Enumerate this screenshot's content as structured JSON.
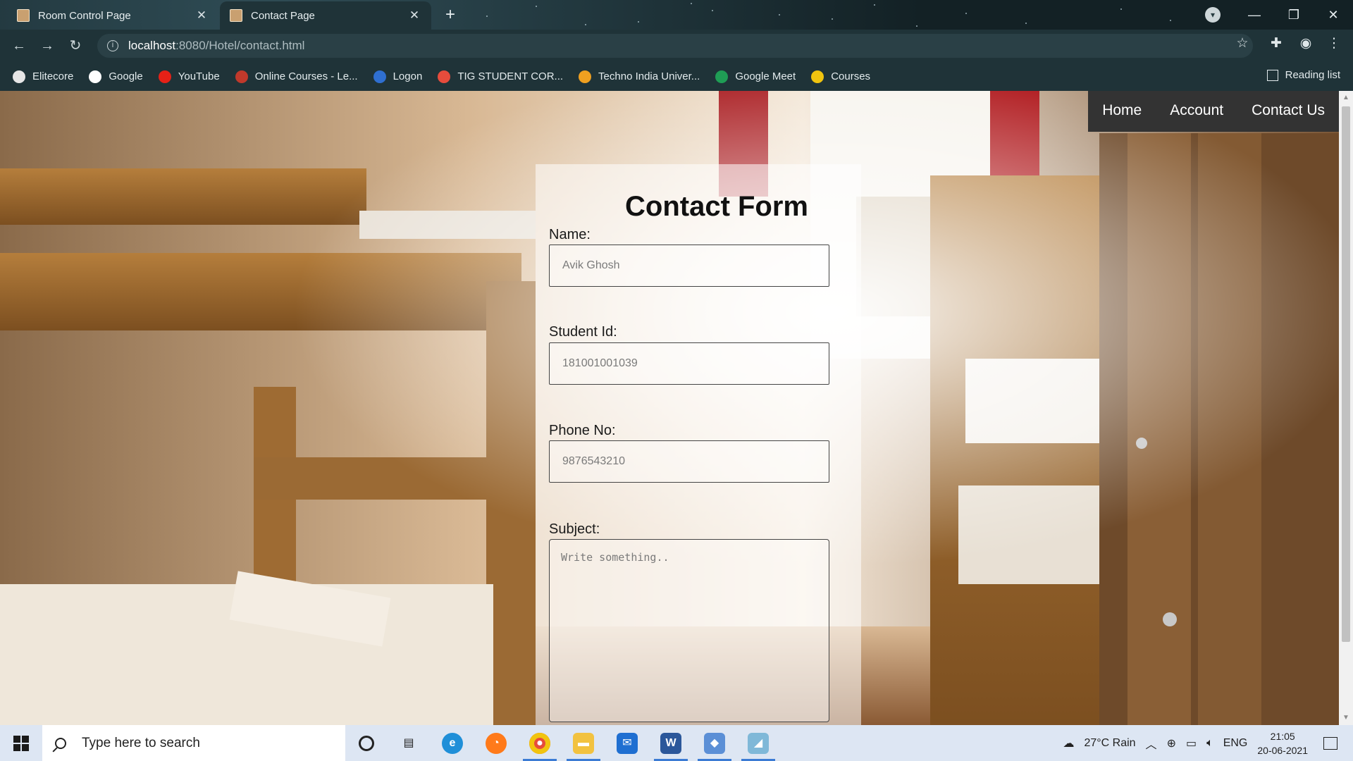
{
  "browser": {
    "tabs": [
      {
        "title": "Room Control Page",
        "active": false
      },
      {
        "title": "Contact Page",
        "active": true
      }
    ],
    "url": {
      "host": "localhost",
      "rest": ":8080/Hotel/contact.html"
    },
    "bookmarks": [
      {
        "label": "Elitecore",
        "color": "#e6e6e6"
      },
      {
        "label": "Google",
        "color": "#ffffff"
      },
      {
        "label": "YouTube",
        "color": "#e62117"
      },
      {
        "label": "Online Courses - Le...",
        "color": "#c0392b"
      },
      {
        "label": "Logon",
        "color": "#2f6fd1"
      },
      {
        "label": "TIG STUDENT COR...",
        "color": "#e74c3c"
      },
      {
        "label": "Techno India Univer...",
        "color": "#f0a020"
      },
      {
        "label": "Google Meet",
        "color": "#1f9d55"
      },
      {
        "label": "Courses",
        "color": "#f1c40f"
      }
    ],
    "reading_list": "Reading list"
  },
  "page": {
    "nav": [
      "Home",
      "Account",
      "Contact Us"
    ],
    "form": {
      "title": "Contact Form",
      "name_label": "Name:",
      "name_placeholder": "Avik Ghosh",
      "student_id_label": "Student Id:",
      "student_id_placeholder": "181001001039",
      "phone_label": "Phone No:",
      "phone_placeholder": "9876543210",
      "subject_label": "Subject:",
      "subject_placeholder": "Write something.."
    }
  },
  "taskbar": {
    "search_placeholder": "Type here to search",
    "weather": "27°C  Rain",
    "language": "ENG",
    "time": "21:05",
    "date": "20-06-2021"
  }
}
